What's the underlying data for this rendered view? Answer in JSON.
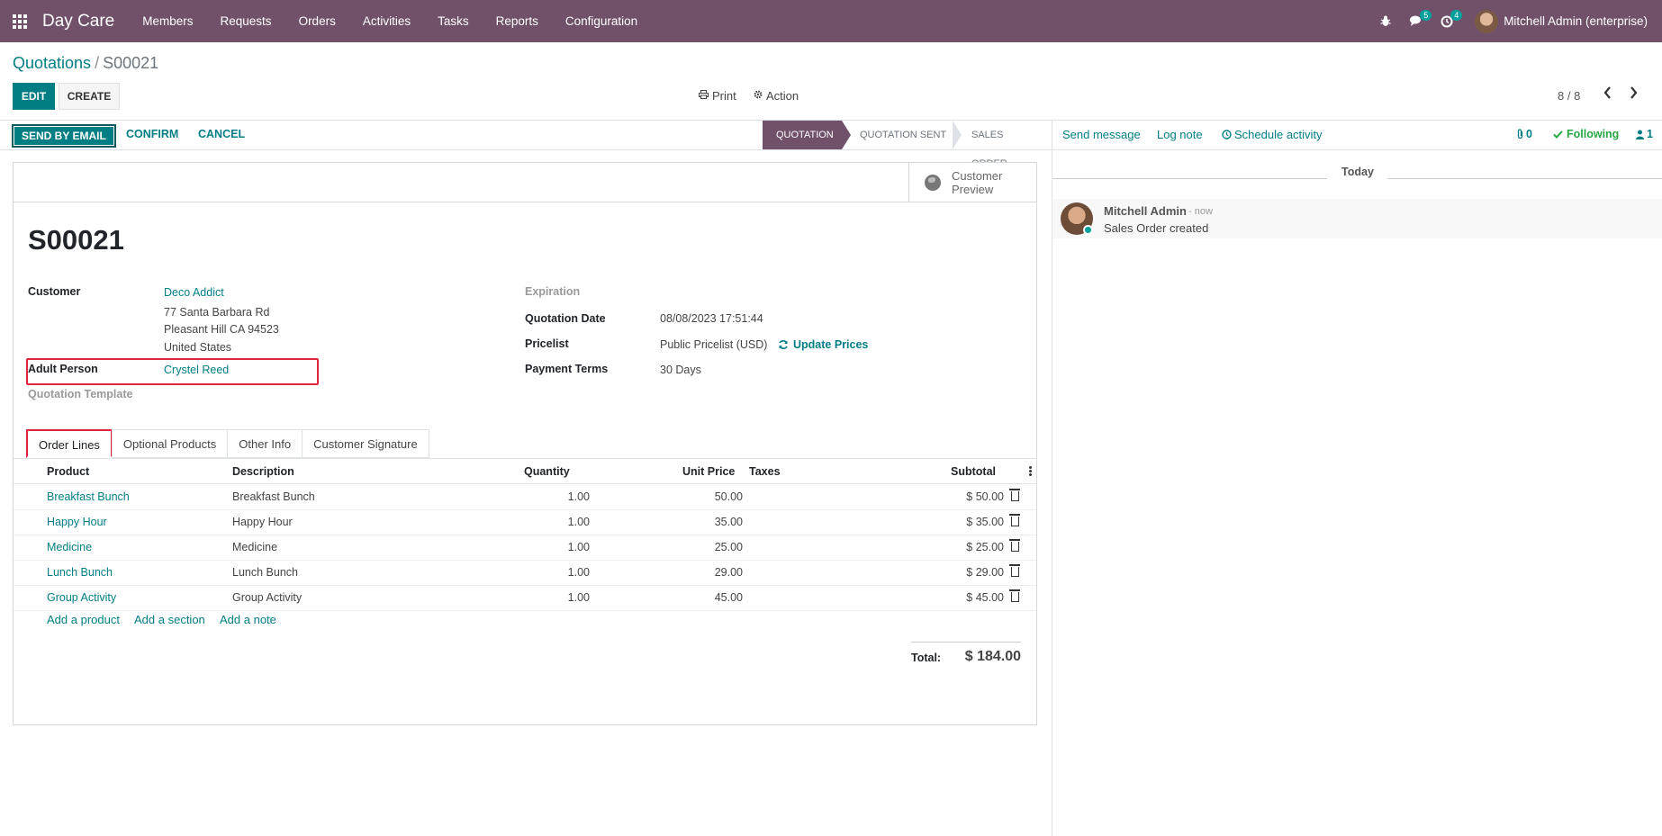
{
  "navbar": {
    "brand": "Day Care",
    "menu": [
      "Members",
      "Requests",
      "Orders",
      "Activities",
      "Tasks",
      "Reports",
      "Configuration"
    ],
    "messages_badge": "5",
    "activities_badge": "4",
    "user": "Mitchell Admin (enterprise)"
  },
  "breadcrumb": {
    "parent": "Quotations",
    "separator": "/",
    "current": "S00021"
  },
  "control": {
    "edit": "EDIT",
    "create": "CREATE",
    "print": "Print",
    "action": "Action",
    "pager": "8 / 8"
  },
  "statusbar": {
    "send_by_email": "SEND BY EMAIL",
    "confirm": "CONFIRM",
    "cancel": "CANCEL",
    "stages": [
      "QUOTATION",
      "QUOTATION SENT",
      "SALES ORDER"
    ],
    "active_stage": "QUOTATION"
  },
  "chatter": {
    "send_message": "Send message",
    "log_note": "Log note",
    "schedule_activity": "Schedule activity",
    "attachments": "0",
    "following": "Following",
    "followers": "1",
    "date_separator": "Today",
    "message": {
      "author": "Mitchell Admin",
      "time": "- now",
      "body": "Sales Order created"
    }
  },
  "form": {
    "smart_button": {
      "line1": "Customer",
      "line2": "Preview"
    },
    "name": "S00021",
    "customer_label": "Customer",
    "customer_name": "Deco Addict",
    "customer_address": [
      "77 Santa Barbara Rd",
      "Pleasant Hill CA 94523",
      "United States"
    ],
    "adult_person_label": "Adult Person",
    "adult_person_value": "Crystel Reed",
    "quotation_template_label": "Quotation Template",
    "expiration_label": "Expiration",
    "quotation_date_label": "Quotation Date",
    "quotation_date_value": "08/08/2023 17:51:44",
    "pricelist_label": "Pricelist",
    "pricelist_value": "Public Pricelist (USD)",
    "update_prices": "Update Prices",
    "payment_terms_label": "Payment Terms",
    "payment_terms_value": "30 Days"
  },
  "tabs": [
    "Order Lines",
    "Optional Products",
    "Other Info",
    "Customer Signature"
  ],
  "order_lines": {
    "headers": {
      "product": "Product",
      "description": "Description",
      "quantity": "Quantity",
      "unit_price": "Unit Price",
      "taxes": "Taxes",
      "subtotal": "Subtotal"
    },
    "rows": [
      {
        "product": "Breakfast Bunch",
        "description": "Breakfast Bunch",
        "quantity": "1.00",
        "unit_price": "50.00",
        "subtotal": "$ 50.00"
      },
      {
        "product": "Happy Hour",
        "description": "Happy Hour",
        "quantity": "1.00",
        "unit_price": "35.00",
        "subtotal": "$ 35.00"
      },
      {
        "product": "Medicine",
        "description": "Medicine",
        "quantity": "1.00",
        "unit_price": "25.00",
        "subtotal": "$ 25.00"
      },
      {
        "product": "Lunch Bunch",
        "description": "Lunch Bunch",
        "quantity": "1.00",
        "unit_price": "29.00",
        "subtotal": "$ 29.00"
      },
      {
        "product": "Group Activity",
        "description": "Group Activity",
        "quantity": "1.00",
        "unit_price": "45.00",
        "subtotal": "$ 45.00"
      }
    ],
    "add_product": "Add a product",
    "add_section": "Add a section",
    "add_note": "Add a note",
    "total_label": "Total:",
    "total_value": "$ 184.00"
  }
}
